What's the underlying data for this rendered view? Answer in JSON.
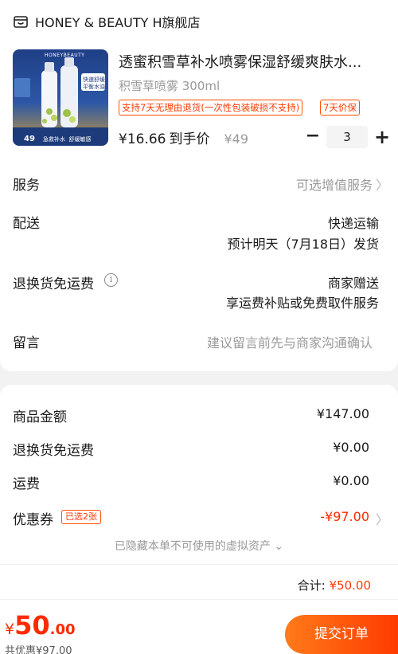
{
  "store": {
    "name": "HONEY & BEAUTY H旗舰店",
    "icon": "shop-icon"
  },
  "product": {
    "title": "透蜜积雪草补水喷雾保湿舒缓爽肤水...",
    "spec": "积雪草喷雾 300ml",
    "tags": [
      "支持7天无理由退货(一次性包装破损不支持)",
      "7天价保"
    ],
    "price_now": "¥16.66",
    "price_label": "到手价",
    "price_orig": "¥49",
    "quantity": "3",
    "minus": "−",
    "plus": "+",
    "image": {
      "brand": "HONEYBEAUTY",
      "badge_lines": [
        "快速舒缓",
        "平衡水油"
      ],
      "price": "49",
      "caption": "急救补水  舒缓敏感"
    }
  },
  "rows": {
    "service": {
      "label": "服务",
      "value": "可选增值服务",
      "chev": "〉"
    },
    "delivery": {
      "label": "配送",
      "line1": "快递运输",
      "line2": "预计明天（7月18日）发货"
    },
    "return_ship": {
      "label": "退换货免运费",
      "info": "i",
      "line1": "商家赠送",
      "line2": "享运费补贴或免费取件服务"
    },
    "message": {
      "label": "留言",
      "placeholder": "建议留言前先与商家沟通确认"
    }
  },
  "summary": {
    "goods": {
      "label": "商品金额",
      "value": "¥147.00"
    },
    "return_fee": {
      "label": "退换货免运费",
      "value": "¥0.00"
    },
    "shipping": {
      "label": "运费",
      "value": "¥0.00"
    },
    "coupon": {
      "label": "优惠券",
      "badge": "已选2张",
      "value": "-¥97.00",
      "chev": "〉"
    },
    "hidden_note": "已隐藏本单不可使用的虚拟资产 ⌄",
    "total_label": "合计:",
    "total_value": "¥50.00"
  },
  "footer": {
    "yen": "¥",
    "amount_int": "50",
    "amount_dec": ".00",
    "saved": "共优惠¥97.00",
    "submit": "提交订单"
  },
  "colors": {
    "accent": "#ff3a00",
    "bg": "#f2f2f2"
  }
}
